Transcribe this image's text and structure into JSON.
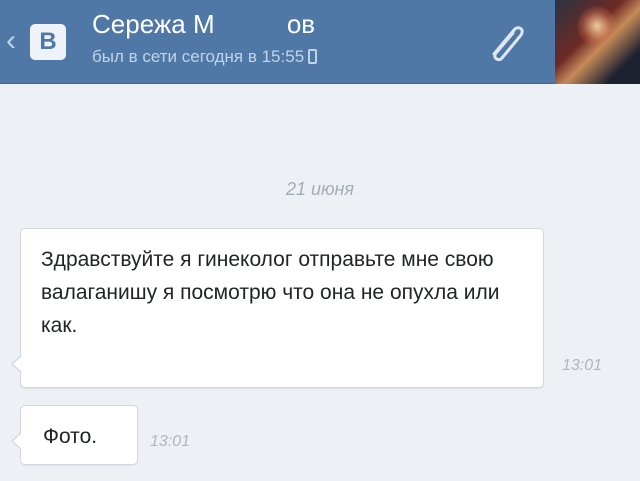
{
  "header": {
    "back_icon": "chevron-left-icon",
    "logo_letter": "B",
    "contact_name": "Сережа М          ов",
    "status": "был в сети сегодня в 15:55",
    "status_icon": "mobile-phone-icon",
    "attach_icon": "paperclip-icon",
    "background_color": "#4f78a6"
  },
  "chat": {
    "date_separator": "21 июня",
    "messages": [
      {
        "text": "Здравствуйте я гинеколог отправьте мне свою валаганишу я посмотрю что она не опухла или как.",
        "time": "13:01"
      },
      {
        "text": "Фото.",
        "time": "13:01"
      }
    ]
  }
}
